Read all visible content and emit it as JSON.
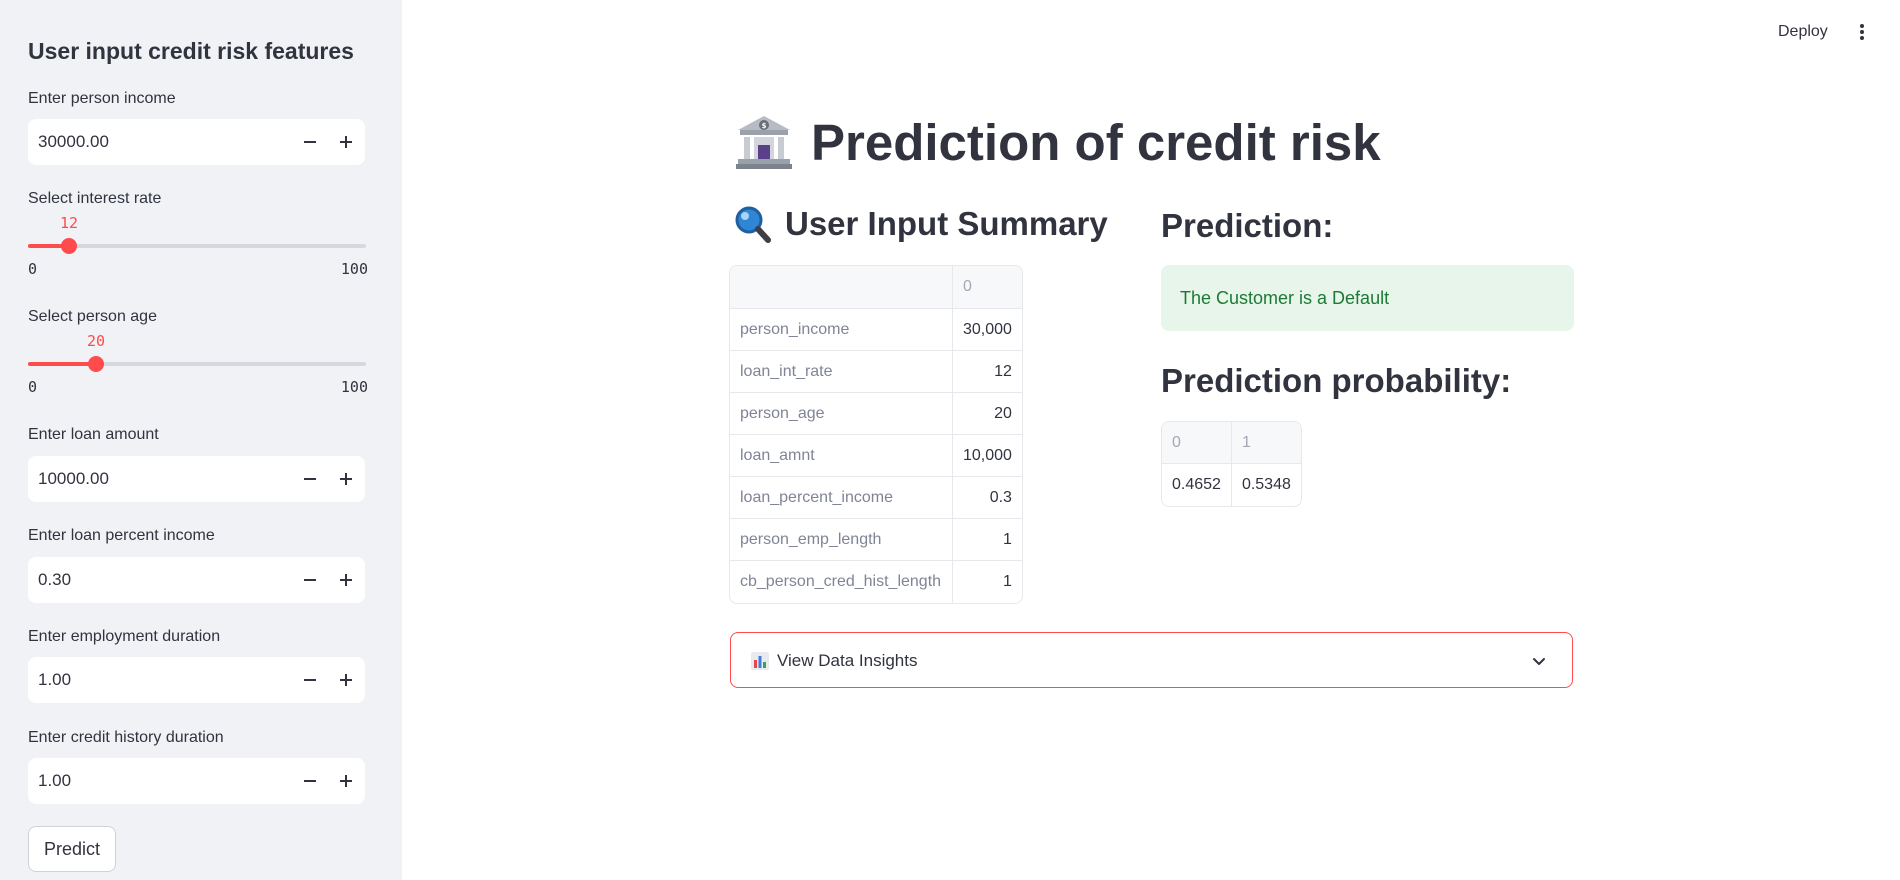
{
  "header": {
    "deploy_label": "Deploy",
    "menu_icon": "kebab-menu-icon"
  },
  "sidebar": {
    "title": "User input credit risk features",
    "person_income": {
      "label": "Enter person income",
      "value": "30000.00"
    },
    "interest_rate": {
      "label": "Select interest rate",
      "value": "12",
      "min": "0",
      "max": "100",
      "level": 0.12
    },
    "person_age": {
      "label": "Select person age",
      "value": "20",
      "min": "0",
      "max": "100",
      "level": 0.2
    },
    "loan_amount": {
      "label": "Enter loan amount",
      "value": "10000.00"
    },
    "loan_percent_income": {
      "label": "Enter loan percent income",
      "value": "0.30"
    },
    "employment_duration": {
      "label": "Enter employment duration",
      "value": "1.00"
    },
    "credit_history_duration": {
      "label": "Enter credit history duration",
      "value": "1.00"
    },
    "predict_label": "Predict"
  },
  "main": {
    "title": "Prediction of credit risk",
    "title_icon": "bank-icon",
    "summary": {
      "heading": "User Input Summary",
      "heading_icon": "magnifier-icon",
      "column_header": "0",
      "rows": [
        {
          "name": "person_income",
          "value": "30,000"
        },
        {
          "name": "loan_int_rate",
          "value": "12"
        },
        {
          "name": "person_age",
          "value": "20"
        },
        {
          "name": "loan_amnt",
          "value": "10,000"
        },
        {
          "name": "loan_percent_income",
          "value": "0.3"
        },
        {
          "name": "person_emp_length",
          "value": "1"
        },
        {
          "name": "cb_person_cred_hist_length",
          "value": "1"
        }
      ]
    },
    "prediction": {
      "heading": "Prediction:",
      "result": "The Customer is a Default"
    },
    "probability": {
      "heading": "Prediction probability:",
      "headers": [
        "0",
        "1"
      ],
      "values": [
        "0.4652",
        "0.5348"
      ]
    },
    "expander": {
      "label": "View Data Insights",
      "icon": "bar-chart-icon"
    }
  },
  "colors": {
    "accent": "#ff4b4b",
    "success_bg": "#e7f5ea",
    "success_text": "#1d7a35",
    "sidebar_bg": "#f0f2f6"
  }
}
